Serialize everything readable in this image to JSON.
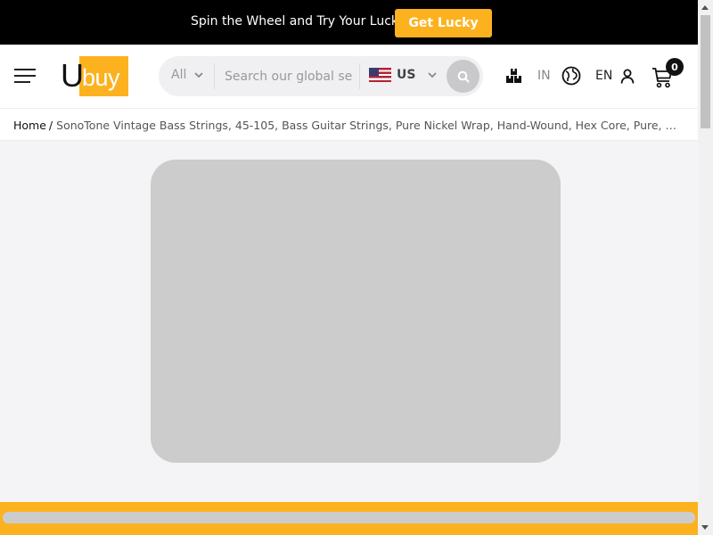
{
  "promo": {
    "text": "Spin the Wheel and Try Your Luck",
    "button_label": "Get Lucky"
  },
  "header": {
    "logo_u": "U",
    "logo_buy": "buy",
    "search": {
      "category": "All",
      "placeholder": "Search our global se",
      "country": "US"
    },
    "ship_to": "IN",
    "language": "EN",
    "cart_count": "0"
  },
  "breadcrumb": {
    "home": "Home",
    "separator": "/",
    "current": "SonoTone Vintage Bass Strings, 45-105, Bass Guitar Strings, Pure Nickel Wrap, Hand-Wound, Hex Core, Pure, Warm, Authentic Tone"
  },
  "colors": {
    "accent": "#fcb21f",
    "banner_bg": "#000000",
    "placeholder_gray": "#cccccc"
  },
  "icons": {
    "menu": "hamburger-menu-icon",
    "chevron": "chevron-down-icon",
    "search": "search-icon",
    "ship": "shipping-boxes-icon",
    "globe": "globe-icon",
    "user": "user-icon",
    "cart": "cart-icon"
  }
}
